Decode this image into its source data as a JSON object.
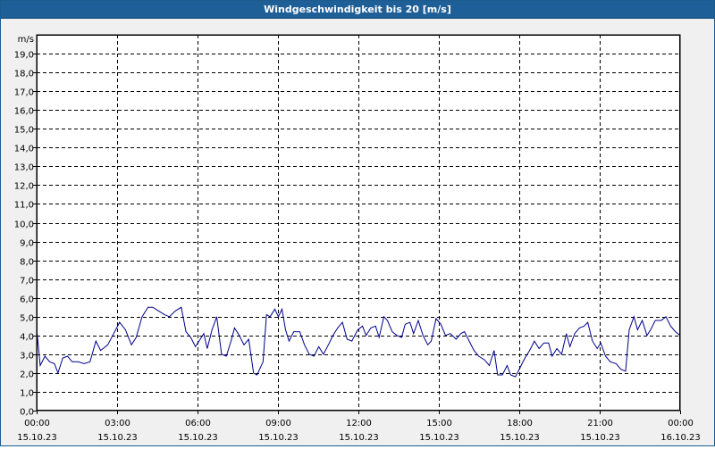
{
  "window": {
    "title": "Windgeschwindigkeit bis 20 [m/s]"
  },
  "chart_data": {
    "type": "line",
    "title": "Windgeschwindigkeit bis 20 [m/s]",
    "ylabel": "m/s",
    "ylim": [
      0,
      20
    ],
    "yticks": [
      "0,0",
      "1,0",
      "2,0",
      "3,0",
      "4,0",
      "5,0",
      "6,0",
      "7,0",
      "8,0",
      "9,0",
      "10,0",
      "11,0",
      "12,0",
      "13,0",
      "14,0",
      "15,0",
      "16,0",
      "17,0",
      "18,0",
      "19,0"
    ],
    "xlim": [
      0,
      24
    ],
    "xticks": [
      {
        "time": "00:00",
        "date": "15.10.23"
      },
      {
        "time": "03:00",
        "date": "15.10.23"
      },
      {
        "time": "06:00",
        "date": "15.10.23"
      },
      {
        "time": "09:00",
        "date": "15.10.23"
      },
      {
        "time": "12:00",
        "date": "15.10.23"
      },
      {
        "time": "15:00",
        "date": "15.10.23"
      },
      {
        "time": "18:00",
        "date": "15.10.23"
      },
      {
        "time": "21:00",
        "date": "15.10.23"
      },
      {
        "time": "00:00",
        "date": "16.10.23"
      }
    ],
    "grid": true,
    "series": [
      {
        "color": "#00008b",
        "points": [
          [
            0.0,
            4.4
          ],
          [
            0.15,
            2.4
          ],
          [
            0.35,
            2.9
          ],
          [
            0.55,
            2.6
          ],
          [
            0.75,
            2.5
          ],
          [
            0.9,
            2.0
          ],
          [
            1.1,
            2.8
          ],
          [
            1.3,
            2.9
          ],
          [
            1.5,
            2.6
          ],
          [
            1.75,
            2.6
          ],
          [
            2.0,
            2.5
          ],
          [
            2.25,
            2.6
          ],
          [
            2.5,
            3.7
          ],
          [
            2.7,
            3.2
          ],
          [
            3.0,
            3.5
          ],
          [
            3.25,
            4.1
          ],
          [
            3.5,
            4.7
          ],
          [
            3.75,
            4.3
          ],
          [
            4.0,
            3.5
          ],
          [
            4.2,
            3.9
          ],
          [
            4.45,
            5.0
          ],
          [
            4.7,
            5.5
          ],
          [
            4.9,
            5.5
          ],
          [
            5.15,
            5.3
          ],
          [
            5.4,
            5.1
          ],
          [
            5.6,
            5.0
          ],
          [
            5.85,
            5.3
          ],
          [
            6.1,
            5.5
          ],
          [
            6.3,
            4.2
          ],
          [
            6.5,
            3.9
          ],
          [
            6.7,
            3.4
          ],
          [
            6.9,
            3.8
          ],
          [
            7.05,
            4.1
          ],
          [
            7.2,
            3.3
          ],
          [
            7.4,
            4.3
          ],
          [
            7.6,
            5.0
          ],
          [
            7.8,
            3.0
          ],
          [
            8.0,
            2.9
          ],
          [
            8.2,
            3.7
          ],
          [
            8.35,
            4.4
          ],
          [
            8.55,
            4.0
          ],
          [
            8.75,
            3.5
          ],
          [
            8.95,
            3.8
          ],
          [
            9.15,
            2.0
          ],
          [
            9.3,
            1.9
          ],
          [
            9.55,
            2.6
          ],
          [
            9.7,
            5.1
          ],
          [
            9.85,
            5.0
          ],
          [
            10.05,
            5.4
          ],
          [
            10.2,
            5.0
          ],
          [
            10.35,
            5.4
          ],
          [
            10.5,
            4.3
          ],
          [
            10.65,
            3.7
          ],
          [
            10.85,
            4.2
          ],
          [
            11.1,
            4.2
          ],
          [
            11.3,
            3.5
          ],
          [
            11.5,
            3.0
          ],
          [
            11.7,
            2.9
          ],
          [
            11.9,
            3.4
          ],
          [
            12.1,
            3.0
          ],
          [
            12.35,
            3.6
          ],
          [
            12.5,
            4.0
          ],
          [
            12.7,
            4.4
          ],
          [
            12.9,
            4.7
          ],
          [
            13.1,
            3.8
          ],
          [
            13.3,
            3.7
          ],
          [
            13.55,
            4.3
          ],
          [
            13.75,
            4.5
          ],
          [
            13.9,
            4.0
          ],
          [
            14.1,
            4.4
          ],
          [
            14.3,
            4.5
          ],
          [
            14.45,
            3.9
          ],
          [
            14.65,
            5.0
          ],
          [
            14.8,
            4.8
          ],
          [
            15.0,
            4.2
          ],
          [
            15.2,
            4.0
          ],
          [
            15.4,
            3.9
          ],
          [
            15.55,
            4.6
          ],
          [
            15.75,
            4.7
          ],
          [
            15.9,
            4.1
          ],
          [
            16.1,
            4.8
          ],
          [
            16.3,
            4.0
          ],
          [
            16.5,
            3.5
          ],
          [
            16.65,
            3.7
          ],
          [
            16.85,
            4.9
          ],
          [
            17.05,
            4.6
          ],
          [
            17.25,
            4.0
          ],
          [
            17.45,
            4.1
          ],
          [
            17.7,
            3.8
          ],
          [
            17.9,
            4.1
          ],
          [
            18.05,
            4.2
          ],
          [
            18.25,
            3.7
          ],
          [
            18.45,
            3.2
          ],
          [
            18.65,
            2.9
          ],
          [
            18.9,
            2.7
          ],
          [
            19.1,
            2.4
          ],
          [
            19.3,
            3.2
          ],
          [
            19.45,
            1.9
          ],
          [
            19.65,
            1.9
          ],
          [
            19.85,
            2.4
          ],
          [
            20.0,
            1.9
          ],
          [
            20.2,
            1.8
          ],
          [
            20.4,
            2.3
          ],
          [
            20.6,
            2.8
          ],
          [
            20.8,
            3.2
          ],
          [
            21.0,
            3.7
          ],
          [
            21.2,
            3.3
          ],
          [
            21.4,
            3.6
          ],
          [
            21.6,
            3.6
          ],
          [
            21.75,
            2.9
          ],
          [
            21.95,
            3.3
          ],
          [
            22.15,
            3.0
          ],
          [
            22.35,
            4.1
          ],
          [
            22.5,
            3.4
          ],
          [
            22.7,
            4.1
          ],
          [
            22.9,
            4.4
          ],
          [
            23.1,
            4.5
          ],
          [
            23.25,
            4.7
          ],
          [
            23.45,
            3.7
          ],
          [
            23.65,
            3.3
          ],
          [
            23.8,
            3.6
          ],
          [
            24.0,
            2.9
          ],
          [
            24.2,
            2.6
          ],
          [
            24.45,
            2.5
          ],
          [
            24.65,
            2.2
          ],
          [
            24.85,
            2.1
          ],
          [
            25.0,
            4.3
          ],
          [
            25.2,
            5.0
          ],
          [
            25.35,
            4.3
          ],
          [
            25.55,
            4.8
          ],
          [
            25.75,
            4.0
          ],
          [
            25.9,
            4.3
          ],
          [
            26.1,
            4.8
          ],
          [
            26.35,
            4.8
          ],
          [
            26.55,
            5.0
          ],
          [
            26.75,
            4.5
          ],
          [
            26.95,
            4.2
          ],
          [
            27.15,
            4.0
          ]
        ]
      }
    ]
  }
}
